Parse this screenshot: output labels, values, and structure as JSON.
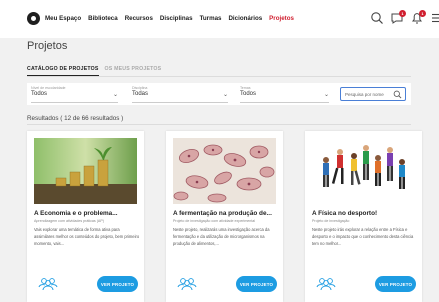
{
  "nav": {
    "links": [
      "Meu Espaço",
      "Biblioteca",
      "Recursos",
      "Disciplinas",
      "Turmas",
      "Dicionários",
      "Projetos"
    ],
    "active_index": 6,
    "notifications_count": "1",
    "messages_count": "1",
    "accent_color": "#d01f2f"
  },
  "page": {
    "title": "Projetos"
  },
  "tabs": [
    {
      "label": "CATÁLOGO DE PROJETOS",
      "active": true
    },
    {
      "label": "OS MEUS PROJETOS",
      "active": false
    }
  ],
  "filters": [
    {
      "label": "Nível de escolaridade",
      "value": "Todos"
    },
    {
      "label": "Disciplina",
      "value": "Todas"
    },
    {
      "label": "Temas",
      "value": "Todos"
    }
  ],
  "search": {
    "placeholder": "Pesquisa por nome",
    "icon": "search-icon"
  },
  "results_text": "Resultados ( 12 de 66 resultados )",
  "cards": [
    {
      "title": "A Economia e o problema...",
      "subtitle": "Aprendizagem com atividades práticas (AP)",
      "description": "Vais explorar uma temática de forma ativa para assimilares melhor os conteúdos do projeto, bem primeiro momento, vais...",
      "button": "VER PROJETO",
      "image": "coins-plant"
    },
    {
      "title": "A fermentação na produção de...",
      "subtitle": "Projeto de investigação com atividade experimental",
      "description": "Neste projeto, realizarás uma investigação acerca da fermentação e da utilização de microrganismos na produção de alimentos,...",
      "button": "VER PROJETO",
      "image": "yeast-cells"
    },
    {
      "title": "A Física no desporto!",
      "subtitle": "Projeto de investigação",
      "description": "Neste projeto irás explorar a relação entre a Física e desporto e o impacto que o conhecimento desta ciência tem no melhor...",
      "button": "VER PROJETO",
      "image": "athletes"
    }
  ],
  "colors": {
    "button": "#1d9ce2",
    "users_icon": "#1d9ce2"
  }
}
